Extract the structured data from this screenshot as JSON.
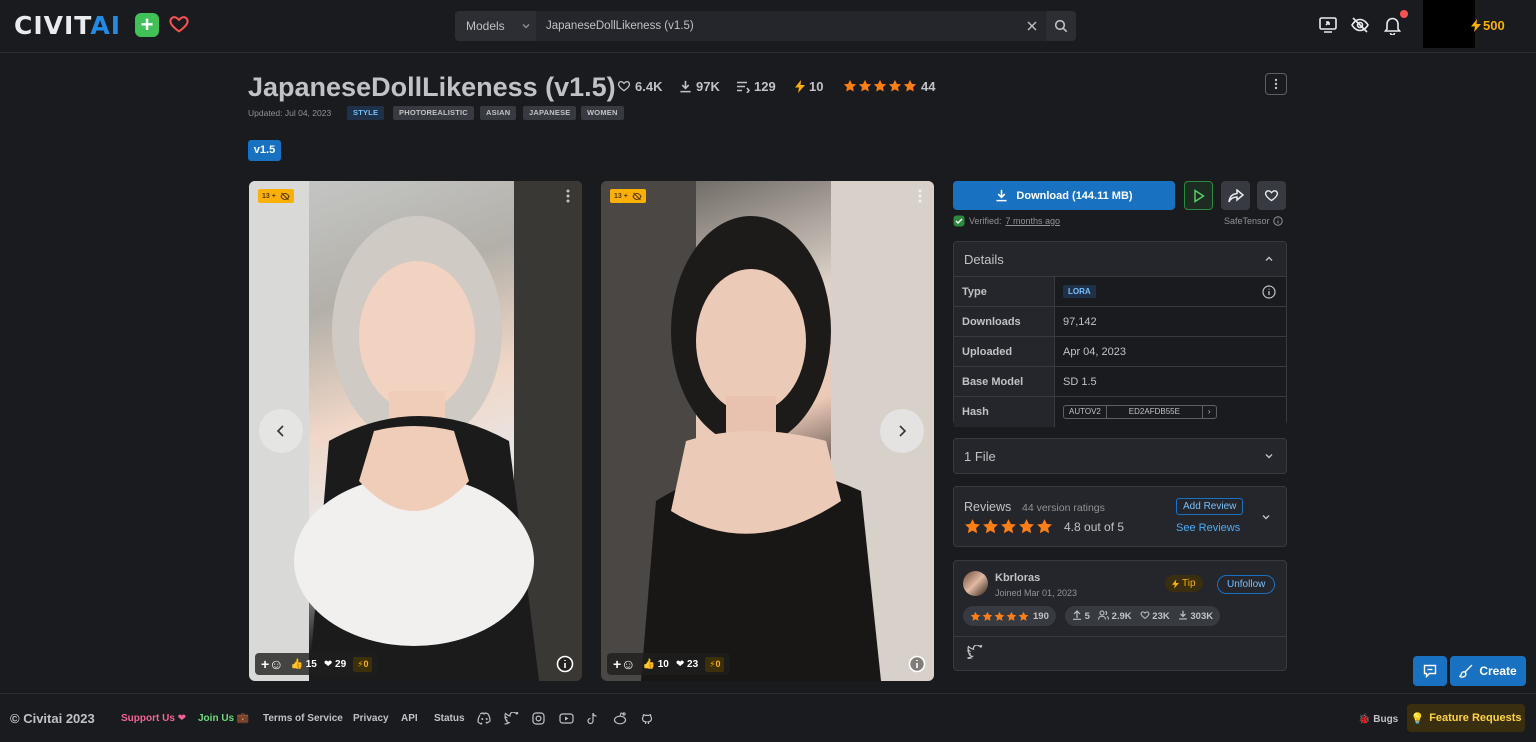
{
  "header": {
    "logo_prefix": "CIVIT",
    "logo_suffix": "AI",
    "search_category": "Models",
    "search_value": "JapaneseDollLikeness (v1.5)",
    "buzz_count": "500"
  },
  "model": {
    "title": "JapaneseDollLikeness (v1.5)",
    "likes": "6.4K",
    "downloads": "97K",
    "comments": "129",
    "buzz": "10",
    "rating_count": "44",
    "updated": "Updated: Jul 04, 2023",
    "tags": [
      "STYLE",
      "PHOTOREALISTIC",
      "ASIAN",
      "JAPANESE",
      "WOMEN"
    ],
    "version": "v1.5"
  },
  "images": [
    {
      "nsfw": "13 +",
      "thumbs": "15",
      "hearts": "29",
      "buzz": "0"
    },
    {
      "nsfw": "13 +",
      "thumbs": "10",
      "hearts": "23",
      "buzz": "0"
    }
  ],
  "download": {
    "label": "Download (144.11 MB)",
    "verified_prefix": "Verified:",
    "verified_time": "7 months ago",
    "format": "SafeTensor"
  },
  "details": {
    "heading": "Details",
    "rows": {
      "type_label": "Type",
      "type_value": "LORA",
      "downloads_label": "Downloads",
      "downloads_value": "97,142",
      "uploaded_label": "Uploaded",
      "uploaded_value": "Apr 04, 2023",
      "base_label": "Base Model",
      "base_value": "SD 1.5",
      "hash_label": "Hash",
      "hash_algo": "AUTOV2",
      "hash_value": "ED2AFDB55E"
    }
  },
  "files": {
    "heading": "1 File"
  },
  "reviews": {
    "heading": "Reviews",
    "count_text": "44 version ratings",
    "rating_text": "4.8 out of 5",
    "add_label": "Add Review",
    "see_label": "See Reviews"
  },
  "creator": {
    "name": "Kbrloras",
    "joined": "Joined Mar 01, 2023",
    "tip_label": "Tip",
    "unfollow_label": "Unfollow",
    "rating_count": "190",
    "uploads": "5",
    "followers": "2.9K",
    "likes": "23K",
    "downloads": "303K"
  },
  "footer": {
    "copyright": "© Civitai 2023",
    "support": "Support Us",
    "join": "Join Us",
    "terms": "Terms of Service",
    "privacy": "Privacy",
    "api": "API",
    "status": "Status",
    "bugs": "Bugs",
    "feature": "Feature Requests"
  },
  "fab": {
    "create_label": "Create"
  },
  "colors": {
    "accent": "#1971c2",
    "star": "#fd7e14",
    "buzz": "#fab005",
    "bg": "#1a1b1e"
  }
}
